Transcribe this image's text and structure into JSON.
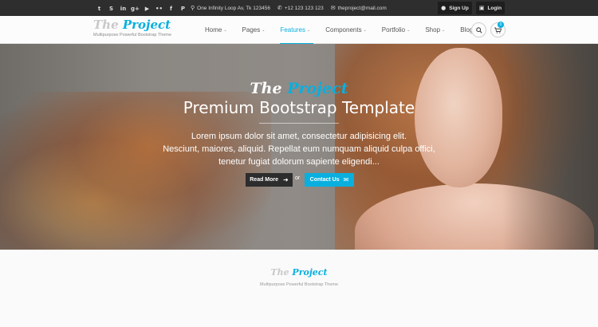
{
  "colors": {
    "accent": "#09afdf",
    "topbar": "#2e2e2e",
    "dark_button": "#2d2d2d"
  },
  "topbar": {
    "social_icons": [
      {
        "name": "twitter-icon",
        "glyph": "t"
      },
      {
        "name": "skype-icon",
        "glyph": "S"
      },
      {
        "name": "linkedin-icon",
        "glyph": "in"
      },
      {
        "name": "googleplus-icon",
        "glyph": "g+"
      },
      {
        "name": "youtube-icon",
        "glyph": "▶"
      },
      {
        "name": "flickr-icon",
        "glyph": "••"
      },
      {
        "name": "facebook-icon",
        "glyph": "f"
      },
      {
        "name": "pinterest-icon",
        "glyph": "P"
      }
    ],
    "address": "One Infinity Loop Av, Tk 123456",
    "phone": "+12 123 123 123",
    "email": "theproject@mail.com",
    "signup_label": "Sign Up",
    "login_label": "Login"
  },
  "header": {
    "logo_word1": "The",
    "logo_word2": "Project",
    "tagline": "Multipurpose Powerful Bootstrap Theme",
    "nav": [
      "Home",
      "Pages",
      "Features",
      "Components",
      "Portfolio",
      "Shop",
      "Blog"
    ],
    "active_nav": "Features",
    "cart_count": "0"
  },
  "hero": {
    "brand_word1": "The",
    "brand_word2": "Project",
    "title": "Premium Bootstrap Template",
    "text_lines": [
      "Lorem ipsum dolor sit amet, consectetur adipisicing elit.",
      "Nesciunt, maiores, aliquid. Repellat eum numquam aliquid culpa offici,",
      "tenetur fugiat dolorum sapiente eligendi..."
    ],
    "read_more_label": "Read More",
    "or_label": "or",
    "contact_label": "Contact Us"
  },
  "footer": {
    "logo_word1": "The",
    "logo_word2": "Project",
    "tagline": "Multipurpose Powerful Bootstrap Theme"
  }
}
